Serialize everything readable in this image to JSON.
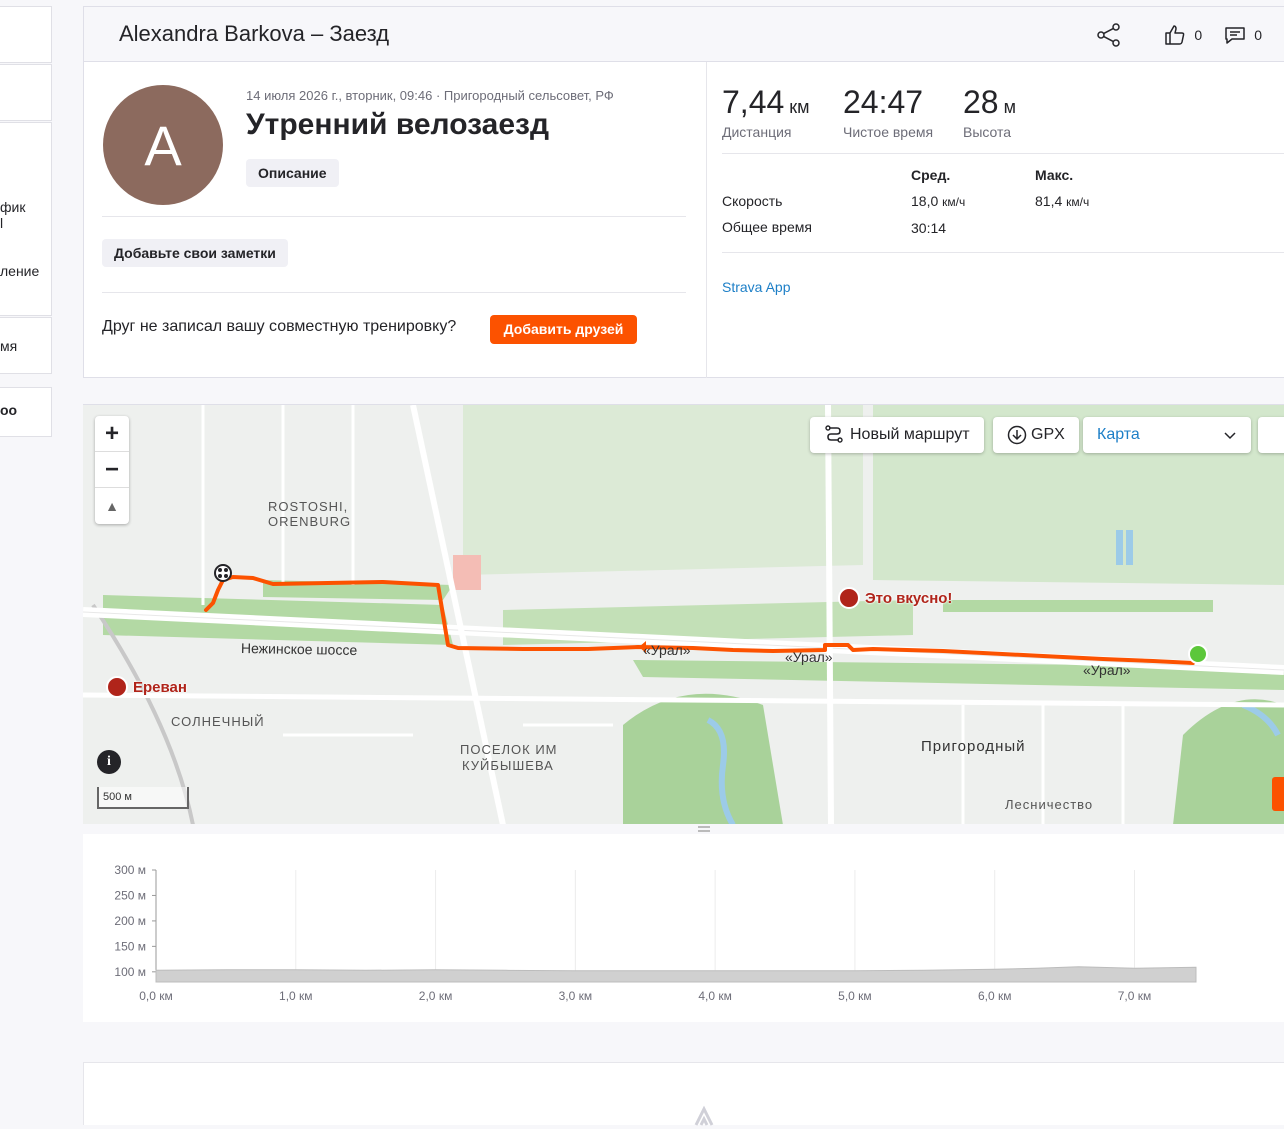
{
  "sidebar": {
    "frag1": "фик",
    "frag1b": "l",
    "frag2": "ление",
    "frag3": "мя",
    "frag4": "oo"
  },
  "header": {
    "title": "Alexandra Barkova – Заезд",
    "kudos_count": "0",
    "comments_count": "0"
  },
  "activity": {
    "avatar_letter": "A",
    "meta": "14 июля 2026 г., вторник, 09:46 · Пригородный сельсовет, РФ",
    "title": "Утренний велозаезд",
    "description_label": "Описание",
    "notes_label": "Добавьте свои заметки",
    "friend_question": "Друг не записал вашу совместную тренировку?",
    "add_friends_label": "Добавить друзей"
  },
  "stats": {
    "distance": {
      "value": "7,44",
      "unit": "км",
      "label": "Дистанция"
    },
    "moving_time": {
      "value": "24:47",
      "label": "Чистое время"
    },
    "elevation": {
      "value": "28",
      "unit": "м",
      "label": "Высота"
    },
    "col_avg": "Сред.",
    "col_max": "Макс.",
    "speed_label": "Скорость",
    "speed_avg": "18,0",
    "speed_max": "81,4",
    "speed_unit": "км/ч",
    "elapsed_label": "Общее время",
    "elapsed_value": "30:14",
    "device": "Strava App"
  },
  "map": {
    "new_route": "Новый маршрут",
    "gpx": "GPX",
    "map_type": "Карта",
    "scale": "500 м",
    "labels": {
      "rostoshi1": "ROSTOSHI,",
      "rostoshi2": "ORENBURG",
      "highway": "Нежинское шоссе",
      "ural1": "«Урал»",
      "ural2": "«Урал»",
      "ural3": "«Урал»",
      "solnechny": "СОЛНЕЧНЫЙ",
      "kuib1": "ПОСЕЛОК ИМ",
      "kuib2": "КУЙБЫШЕВА",
      "prigorodny": "Пригородный",
      "lesnichestvo": "Лесничество",
      "poi1": "Это вкусно!",
      "poi2": "Ереван"
    },
    "colors": {
      "route": "#fc5200",
      "start": "#5cc73a",
      "poi": "#b0241a"
    }
  },
  "chart_data": {
    "type": "area",
    "title": "",
    "xlabel": "",
    "ylabel": "",
    "x_ticks": [
      "0,0 км",
      "1,0 км",
      "2,0 км",
      "3,0 км",
      "4,0 км",
      "5,0 км",
      "6,0 км",
      "7,0 км"
    ],
    "y_ticks": [
      "300 м",
      "250 м",
      "200 м",
      "150 м",
      "100 м"
    ],
    "xlim": [
      0,
      7.44
    ],
    "ylim": [
      80,
      300
    ],
    "x": [
      0,
      0.5,
      1.0,
      1.5,
      2.0,
      2.5,
      3.0,
      3.5,
      4.0,
      4.5,
      5.0,
      5.5,
      6.0,
      6.3,
      6.6,
      7.0,
      7.44
    ],
    "y": [
      103,
      104,
      104,
      103,
      104,
      103,
      102,
      102,
      102,
      102,
      102,
      103,
      105,
      107,
      110,
      107,
      109
    ],
    "grid": true,
    "color": "#d0d0d0"
  }
}
